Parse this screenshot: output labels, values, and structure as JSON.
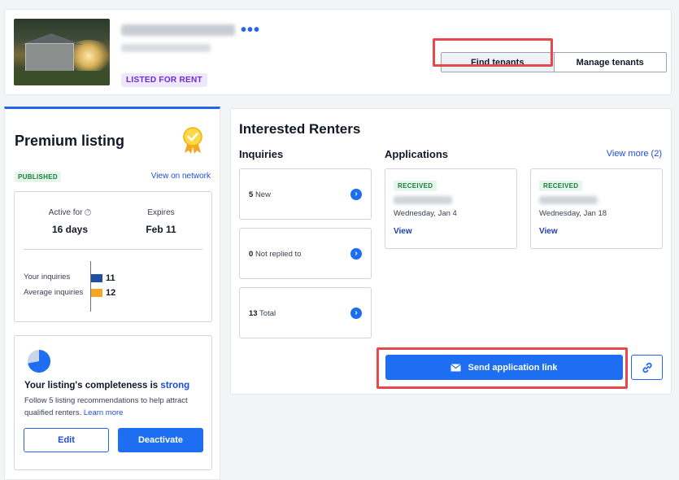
{
  "property": {
    "address_line1": "1190 Lasseline St",
    "address_line2": "Bay Area, CA",
    "status_badge": "LISTED FOR RENT",
    "more_menu": "•••"
  },
  "tabs": [
    {
      "label": "Find tenants",
      "active": true
    },
    {
      "label": "Manage tenants",
      "active": false
    }
  ],
  "premium": {
    "title": "Premium listing",
    "status": "PUBLISHED",
    "view_network": "View on network",
    "active_for_label": "Active for",
    "active_for_value": "16 days",
    "expires_label": "Expires",
    "expires_value": "Feb 11",
    "your_inquiries_label": "Your inquiries",
    "your_inquiries_value": "11",
    "average_inquiries_label": "Average inquiries",
    "average_inquiries_value": "12",
    "completeness_prefix": "Your listing's completeness is",
    "completeness_level": "strong",
    "completeness_fraction": 0.72,
    "recommendation_text": "Follow 5 listing recommendations to help attract qualified renters.",
    "learn_more": "Learn more",
    "edit_label": "Edit",
    "deactivate_label": "Deactivate"
  },
  "renters": {
    "title": "Interested Renters",
    "inquiries_heading": "Inquiries",
    "applications_heading": "Applications",
    "view_more": "View more (2)",
    "inquiries": [
      {
        "count": "5",
        "label": "New"
      },
      {
        "count": "0",
        "label": "Not replied to"
      },
      {
        "count": "13",
        "label": "Total"
      }
    ],
    "applications": [
      {
        "status": "RECEIVED",
        "name": "Applicant A",
        "date": "Wednesday, Jan 4",
        "view": "View"
      },
      {
        "status": "RECEIVED",
        "name": "Applicant B",
        "date": "Wednesday, Jan 18",
        "view": "View"
      }
    ],
    "send_link_label": "Send application link"
  },
  "colors": {
    "primary": "#1d6ef0",
    "highlight": "#e5484d",
    "your_bar": "#1e4fa3",
    "average_bar": "#f5a623"
  }
}
